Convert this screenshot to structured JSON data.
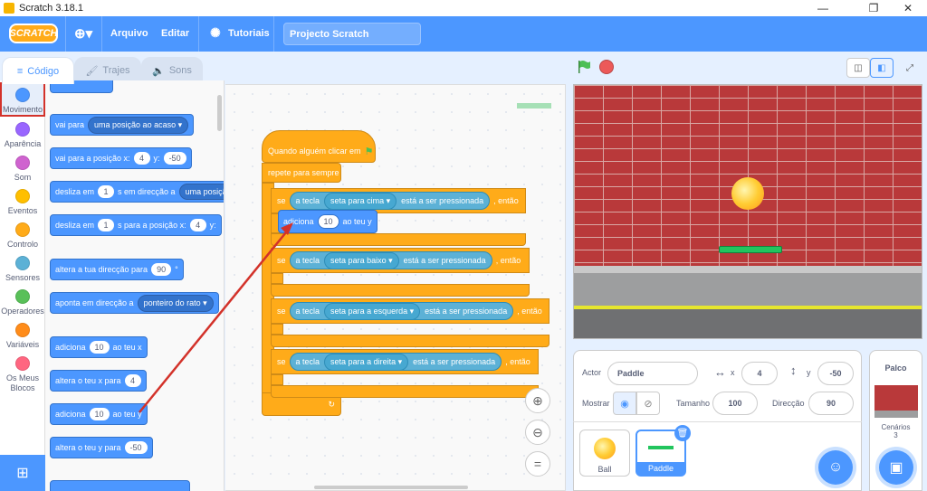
{
  "window": {
    "title": "Scratch 3.18.1"
  },
  "menubar": {
    "logo": "SCRATCH",
    "file": "Arquivo",
    "edit": "Editar",
    "tutorials": "Tutoriais",
    "project_title": "Projecto Scratch"
  },
  "tabs": {
    "code": "Código",
    "costumes": "Trajes",
    "sounds": "Sons"
  },
  "categories": [
    {
      "label": "Movimento",
      "color": "#4c97ff"
    },
    {
      "label": "Aparência",
      "color": "#9966ff"
    },
    {
      "label": "Som",
      "color": "#cf63cf"
    },
    {
      "label": "Eventos",
      "color": "#ffbf00"
    },
    {
      "label": "Controlo",
      "color": "#ffab19"
    },
    {
      "label": "Sensores",
      "color": "#5cb1d6"
    },
    {
      "label": "Operadores",
      "color": "#59c059"
    },
    {
      "label": "Variáveis",
      "color": "#ff8c1a"
    },
    {
      "label": "Os Meus Blocos",
      "color": "#ff6680"
    }
  ],
  "palette": {
    "goto_label": "vai para",
    "goto_opt": "uma posição ao acaso",
    "gotoxy_label": "vai para a posição x:",
    "gotoxy_x": "4",
    "gotoxy_y_label": "y:",
    "gotoxy_y": "-50",
    "glide_label": "desliza em",
    "glide_secs": "1",
    "glide_mid": "s em direcção a",
    "glide_opt": "uma posiçã",
    "glidexy_label": "desliza em",
    "glidexy_secs": "1",
    "glidexy_mid": "s para a posição x:",
    "glidexy_x": "4",
    "glidexy_y_label": "y:",
    "dir_label": "altera a tua direcção para",
    "dir_val": "90",
    "dir_deg": "°",
    "point_label": "aponta em direcção a",
    "point_opt": "ponteiro do rato",
    "changex_label": "adiciona",
    "changex_val": "10",
    "changex_suffix": "ao teu x",
    "setx_label": "altera o teu x para",
    "setx_val": "4",
    "changey_label": "adiciona",
    "changey_val": "10",
    "changey_suffix": "ao teu y",
    "sety_label": "altera o teu y para",
    "sety_val": "-50"
  },
  "script": {
    "hat": "Quando alguém clicar em",
    "forever": "repete para sempre",
    "if_label": "se",
    "then": ", então",
    "key_label": "a tecla",
    "pressed": "está a ser pressionada",
    "keys": [
      "seta para cima",
      "seta para baixo",
      "seta para a esquerda",
      "seta para a direita"
    ],
    "change_label": "adiciona",
    "change_val": "10",
    "change_suffix": "ao teu y"
  },
  "sprite_info": {
    "actor_label": "Actor",
    "actor_name": "Paddle",
    "x_label": "x",
    "x_val": "4",
    "y_label": "y",
    "y_val": "-50",
    "show_label": "Mostrar",
    "size_label": "Tamanho",
    "size_val": "100",
    "dir_label": "Direcção",
    "dir_val": "90"
  },
  "sprites": [
    {
      "name": "Ball",
      "selected": false
    },
    {
      "name": "Paddle",
      "selected": true
    }
  ],
  "stage_panel": {
    "title": "Palco",
    "backdrops_label": "Cenários",
    "backdrops_count": "3"
  }
}
